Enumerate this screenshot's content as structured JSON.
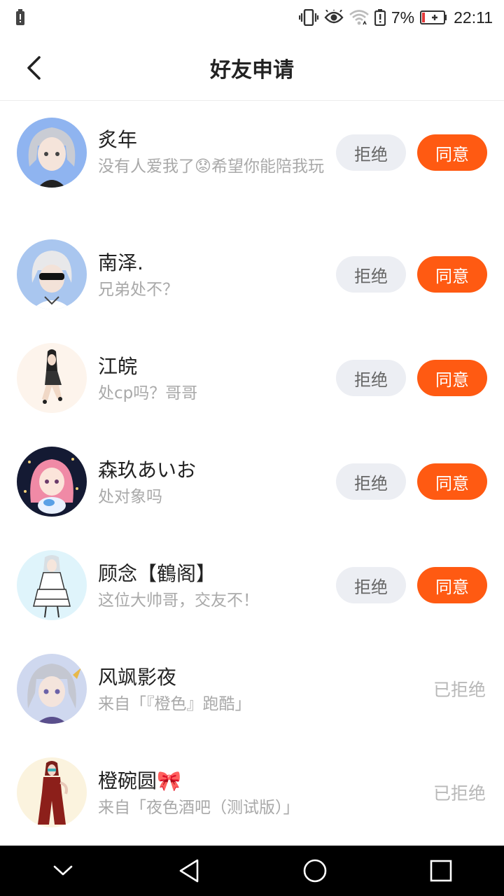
{
  "status_bar": {
    "battery_percent": "7%",
    "time": "22:11"
  },
  "header": {
    "title": "好友申请"
  },
  "requests": [
    {
      "name": "炙年",
      "message": "没有人爱我了😟希望你能陪我玩",
      "state": "pending",
      "reject_label": "拒绝",
      "accept_label": "同意"
    },
    {
      "name": "南泽.",
      "message": "兄弟处不？",
      "state": "pending",
      "reject_label": "拒绝",
      "accept_label": "同意"
    },
    {
      "name": "江皖",
      "message": "处cp吗？哥哥",
      "state": "pending",
      "reject_label": "拒绝",
      "accept_label": "同意"
    },
    {
      "name": "森玖あいお",
      "message": "处对象吗",
      "state": "pending",
      "reject_label": "拒绝",
      "accept_label": "同意"
    },
    {
      "name": "顾念【鶴阁】",
      "message": "这位大帅哥，交友不！",
      "state": "pending",
      "reject_label": "拒绝",
      "accept_label": "同意"
    },
    {
      "name": "风飒影夜",
      "message": "来自「『橙色』跑酷」",
      "state": "rejected",
      "status_label": "已拒绝"
    },
    {
      "name": "橙碗圆🎀",
      "message": "来自「夜色酒吧（测试版）」",
      "state": "rejected",
      "status_label": "已拒绝"
    }
  ],
  "colors": {
    "accent": "#ff5a12",
    "reject_bg": "#eceef3",
    "muted_text": "#a9a9a9"
  }
}
